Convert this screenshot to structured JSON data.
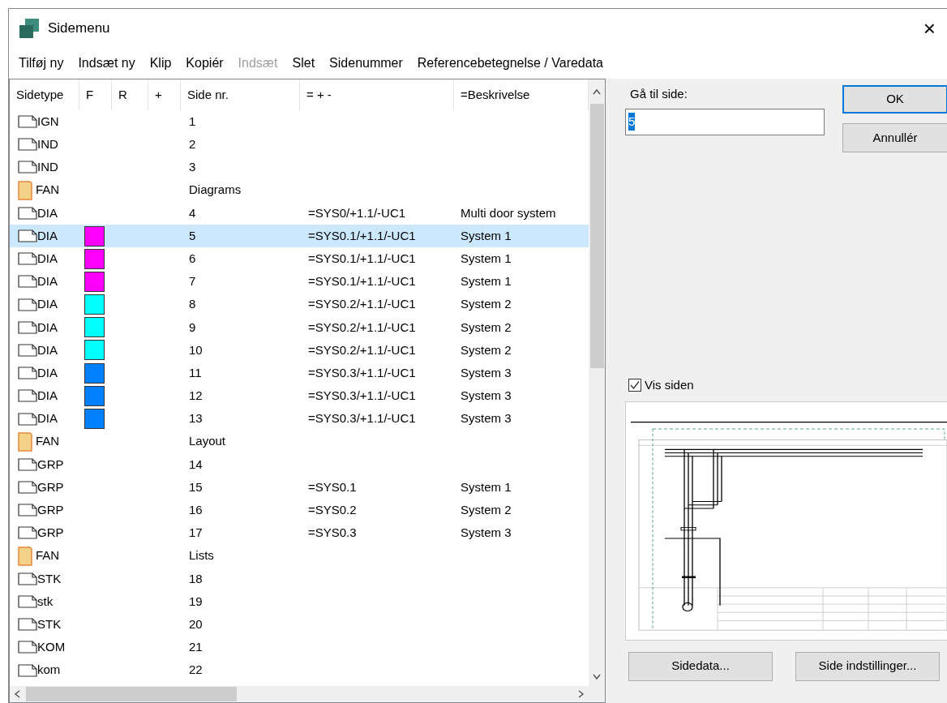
{
  "window": {
    "title": "Sidemenu",
    "close": "×"
  },
  "menu": [
    {
      "label": "Tilføj ny",
      "disabled": false
    },
    {
      "label": "Indsæt ny",
      "disabled": false
    },
    {
      "label": "Klip",
      "disabled": false
    },
    {
      "label": "Kopiér",
      "disabled": false
    },
    {
      "label": "Indsæt",
      "disabled": true
    },
    {
      "label": "Slet",
      "disabled": false
    },
    {
      "label": "Sidenummer",
      "disabled": false
    },
    {
      "label": "Referencebetegnelse / Varedata",
      "disabled": false
    }
  ],
  "table": {
    "columns": [
      "Sidetype",
      "F",
      "R",
      "+",
      "Side nr.",
      "= + -",
      "=Beskrivelse"
    ],
    "rows": [
      {
        "kind": "page",
        "type": "IGN",
        "number": "1",
        "selected": false
      },
      {
        "kind": "page",
        "type": "IND",
        "number": "2",
        "selected": false
      },
      {
        "kind": "page",
        "type": "IND",
        "number": "3",
        "selected": false
      },
      {
        "kind": "folder",
        "type": "FAN",
        "number": "Diagrams",
        "selected": false
      },
      {
        "kind": "page",
        "type": "DIA",
        "number": "4",
        "ref": "=SYS0/+1.1/-UC1",
        "desc": "Multi door system",
        "selected": false
      },
      {
        "kind": "page",
        "type": "DIA",
        "color": "#ff00ff",
        "number": "5",
        "ref": "=SYS0.1/+1.1/-UC1",
        "desc": "System 1",
        "selected": true
      },
      {
        "kind": "page",
        "type": "DIA",
        "color": "#ff00ff",
        "number": "6",
        "ref": "=SYS0.1/+1.1/-UC1",
        "desc": "System 1",
        "selected": false
      },
      {
        "kind": "page",
        "type": "DIA",
        "color": "#ff00ff",
        "number": "7",
        "ref": "=SYS0.1/+1.1/-UC1",
        "desc": "System 1",
        "selected": false
      },
      {
        "kind": "page",
        "type": "DIA",
        "color": "#00ffff",
        "number": "8",
        "ref": "=SYS0.2/+1.1/-UC1",
        "desc": "System 2",
        "selected": false
      },
      {
        "kind": "page",
        "type": "DIA",
        "color": "#00ffff",
        "number": "9",
        "ref": "=SYS0.2/+1.1/-UC1",
        "desc": "System 2",
        "selected": false
      },
      {
        "kind": "page",
        "type": "DIA",
        "color": "#00ffff",
        "number": "10",
        "ref": "=SYS0.2/+1.1/-UC1",
        "desc": "System 2",
        "selected": false
      },
      {
        "kind": "page",
        "type": "DIA",
        "color": "#0080ff",
        "number": "11",
        "ref": "=SYS0.3/+1.1/-UC1",
        "desc": "System 3",
        "selected": false
      },
      {
        "kind": "page",
        "type": "DIA",
        "color": "#0080ff",
        "number": "12",
        "ref": "=SYS0.3/+1.1/-UC1",
        "desc": "System 3",
        "selected": false
      },
      {
        "kind": "page",
        "type": "DIA",
        "color": "#0080ff",
        "number": "13",
        "ref": "=SYS0.3/+1.1/-UC1",
        "desc": "System 3",
        "selected": false
      },
      {
        "kind": "folder",
        "type": "FAN",
        "number": "Layout",
        "selected": false
      },
      {
        "kind": "page",
        "type": "GRP",
        "number": "14",
        "selected": false
      },
      {
        "kind": "page",
        "type": "GRP",
        "number": "15",
        "ref": "=SYS0.1",
        "desc": "System 1",
        "selected": false
      },
      {
        "kind": "page",
        "type": "GRP",
        "number": "16",
        "ref": "=SYS0.2",
        "desc": "System 2",
        "selected": false
      },
      {
        "kind": "page",
        "type": "GRP",
        "number": "17",
        "ref": "=SYS0.3",
        "desc": "System 3",
        "selected": false
      },
      {
        "kind": "folder",
        "type": "FAN",
        "number": "Lists",
        "selected": false
      },
      {
        "kind": "page",
        "type": "STK",
        "number": "18",
        "selected": false
      },
      {
        "kind": "page",
        "type": "stk",
        "number": "19",
        "selected": false
      },
      {
        "kind": "page",
        "type": "STK",
        "number": "20",
        "selected": false
      },
      {
        "kind": "page",
        "type": "KOM",
        "number": "21",
        "selected": false
      },
      {
        "kind": "page",
        "type": "kom",
        "number": "22",
        "selected": false
      }
    ]
  },
  "goto": {
    "label": "Gå til side:",
    "value": "5"
  },
  "buttons": {
    "ok": "OK",
    "cancel": "Annullér",
    "page_data": "Sidedata...",
    "page_settings": "Side indstillinger..."
  },
  "preview": {
    "label": "Vis siden",
    "checked": true
  }
}
